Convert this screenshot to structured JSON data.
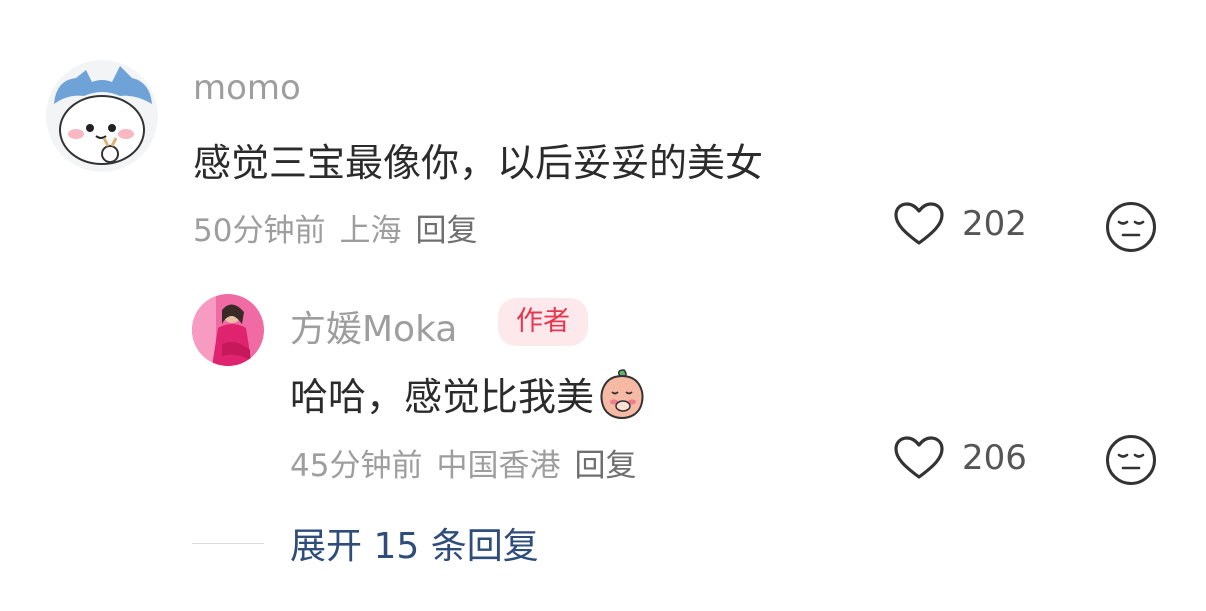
{
  "comment": {
    "username": "momo",
    "text": "感觉三宝最像你，以后妥妥的美女",
    "time": "50分钟前",
    "location": "上海",
    "reply_label": "回复",
    "likes": "202"
  },
  "reply": {
    "username": "方媛Moka",
    "badge": "作者",
    "text": "哈哈，感觉比我美",
    "time": "45分钟前",
    "location": "中国香港",
    "reply_label": "回复",
    "likes": "206"
  },
  "expand_label": "展开 15 条回复",
  "colors": {
    "author_badge_bg": "#fde9ec",
    "author_badge_text": "#e8364f",
    "expand_link": "#2e4d7a"
  }
}
